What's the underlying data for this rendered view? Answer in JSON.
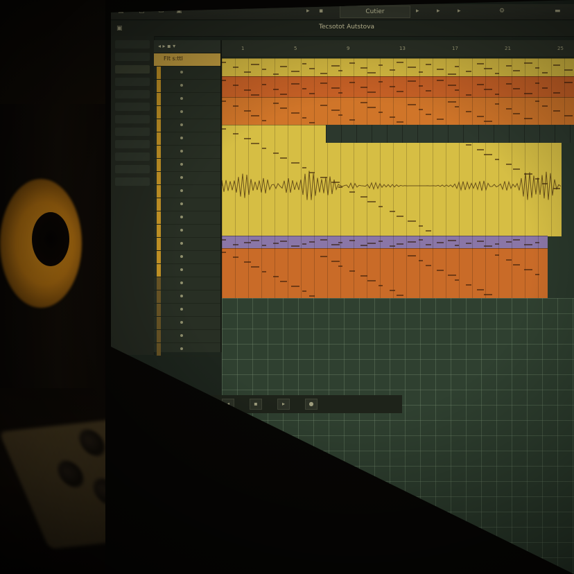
{
  "app": {
    "window_title": "Tecsotot Autstova",
    "tab_label": "Cutier"
  },
  "titlebar": {
    "left_icons": [
      "menu-icon",
      "window-icon",
      "folder-icon",
      "save-icon"
    ],
    "right_icons": [
      "settings-icon",
      "minimize-icon"
    ]
  },
  "track_list": {
    "selected_label": "Flt s:ttl",
    "rows": 22
  },
  "ruler": {
    "ticks": [
      "1",
      "5",
      "9",
      "13",
      "17",
      "21",
      "25"
    ]
  },
  "regions": [
    {
      "name": "region-yellow-top",
      "color": "#d8bf4a"
    },
    {
      "name": "region-orange-1",
      "color": "#c8652a"
    },
    {
      "name": "region-orange-2",
      "color": "#d07a2e"
    },
    {
      "name": "region-yellow-audio",
      "color": "#d6c14c"
    },
    {
      "name": "region-purple",
      "color": "#8a7bb0"
    },
    {
      "name": "region-orange-lower",
      "color": "#c9702d"
    }
  ],
  "colors": {
    "accent_yellow": "#d6c14c",
    "accent_orange": "#c8652a",
    "accent_purple": "#8a7bb0",
    "grid_green": "#2f4336"
  }
}
